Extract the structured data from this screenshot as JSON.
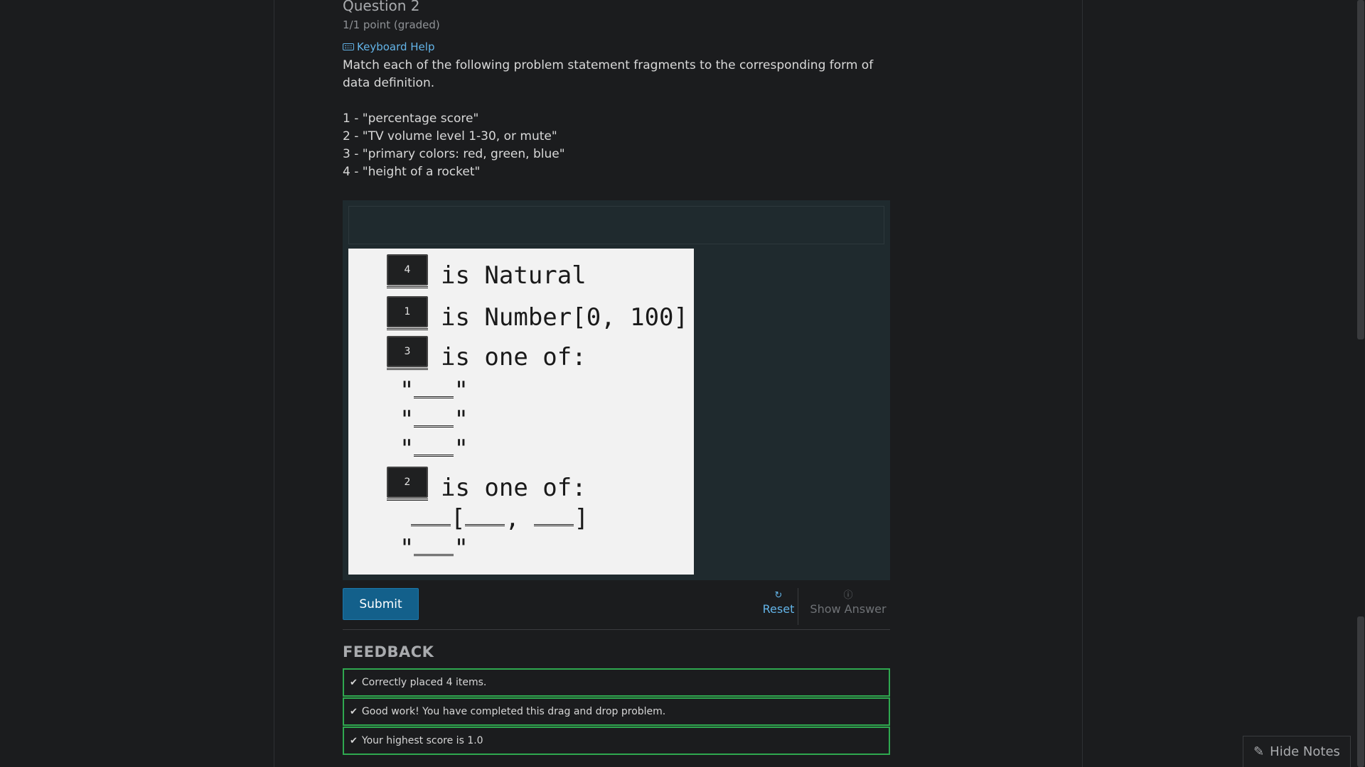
{
  "question": {
    "title": "Question 2",
    "points": "1/1 point (graded)",
    "keyboard_help": "Keyboard Help",
    "prompt_lines": [
      "Match each of the following problem statement fragments to the corresponding form of data definition.",
      "1 - \"percentage score\"",
      "2 - \"TV volume level 1-30, or mute\"",
      "3 - \"primary colors: red, green, blue\"",
      "4 - \"height of a rocket\""
    ]
  },
  "drag_drop": {
    "placed_items": [
      "4",
      "1",
      "3",
      "2"
    ],
    "target_text": {
      "natural": "is Natural",
      "number": "is Number[0, 100]",
      "one_of_1": "is one of:",
      "one_of_2": "is one of:"
    }
  },
  "actions": {
    "submit": "Submit",
    "reset": "Reset",
    "show_answer": "Show Answer"
  },
  "feedback": {
    "title": "FEEDBACK",
    "messages": [
      "Correctly placed 4 items.",
      "Good work! You have completed this drag and drop problem.",
      "Your highest score is 1.0"
    ]
  },
  "notes": {
    "hide_label": "Hide Notes"
  },
  "colors": {
    "accent": "#63b4e8",
    "submit_bg": "#13608b",
    "success_border": "#2fa84f",
    "page_bg": "#1b1c1e"
  }
}
